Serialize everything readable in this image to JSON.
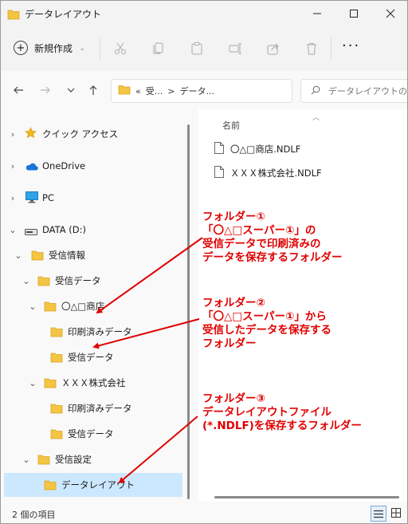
{
  "window": {
    "title": "データレイアウト"
  },
  "toolbar": {
    "new_label": "新規作成"
  },
  "nav": {
    "breadcrumb": [
      "«",
      "受...",
      ">",
      "データ..."
    ],
    "search_placeholder": "データレイアウトの検索"
  },
  "tree": [
    {
      "label": "クイック アクセス",
      "icon": "star-icon",
      "expand": "right"
    },
    {
      "label": "OneDrive",
      "icon": "cloud-icon",
      "expand": "right"
    },
    {
      "label": "PC",
      "icon": "monitor-icon",
      "expand": "right"
    },
    {
      "label": "DATA (D:)",
      "icon": "drive-icon",
      "expand": "down"
    },
    {
      "label": "受信情報",
      "icon": "folder-icon",
      "expand": "down"
    },
    {
      "label": "受信データ",
      "icon": "folder-icon",
      "expand": "down"
    },
    {
      "label": "〇△□商店",
      "icon": "folder-icon",
      "expand": "down"
    },
    {
      "label": "印刷済みデータ",
      "icon": "folder-icon",
      "expand": ""
    },
    {
      "label": "受信データ",
      "icon": "folder-icon",
      "expand": ""
    },
    {
      "label": "ＸＸＸ株式会社",
      "icon": "folder-icon",
      "expand": "down"
    },
    {
      "label": "印刷済みデータ",
      "icon": "folder-icon",
      "expand": ""
    },
    {
      "label": "受信データ",
      "icon": "folder-icon",
      "expand": ""
    },
    {
      "label": "受信設定",
      "icon": "folder-icon",
      "expand": "down"
    },
    {
      "label": "データレイアウト",
      "icon": "folder-icon",
      "expand": "",
      "selected": true
    }
  ],
  "content": {
    "column_name": "名前",
    "files": [
      {
        "name": "〇△□商店.NDLF"
      },
      {
        "name": "ＸＸＸ株式会社.NDLF"
      }
    ]
  },
  "status": {
    "text": "2 個の項目"
  },
  "annotations": [
    {
      "lines": [
        "フォルダー①",
        "「〇△□スーパー①」の",
        "受信データで印刷済みの",
        "データを保存するフォルダー"
      ]
    },
    {
      "lines": [
        "フォルダー②",
        "「〇△□スーパー①」から",
        "受信したデータを保存する",
        "フォルダー"
      ]
    },
    {
      "lines": [
        "フォルダー③",
        "データレイアウトファイル",
        "(*.NDLF)を保存するフォルダー"
      ]
    }
  ],
  "colors": {
    "annotation": "#e00000",
    "selection": "#cce8ff",
    "folder": "#f4c443"
  }
}
